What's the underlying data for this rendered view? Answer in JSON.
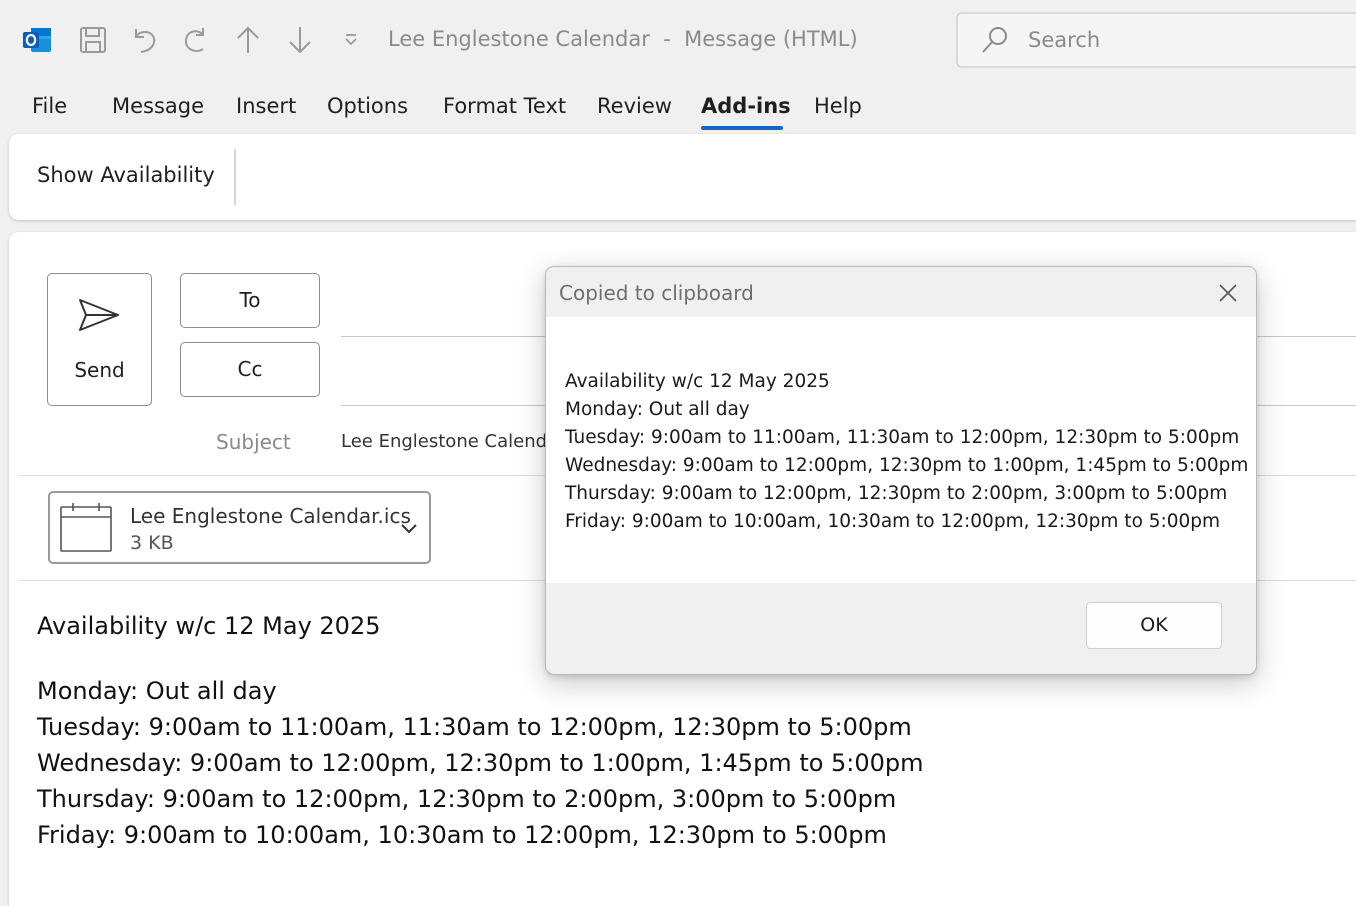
{
  "titlebar": {
    "title": "Lee Englestone Calendar  -  Message (HTML)",
    "search_placeholder": "Search",
    "icons": [
      "outlook-app-icon",
      "save-icon",
      "undo-icon",
      "redo-icon",
      "up-arrow-icon",
      "down-arrow-icon",
      "customize-dropdown-icon"
    ]
  },
  "menu": {
    "items": [
      "File",
      "Message",
      "Insert",
      "Options",
      "Format Text",
      "Review",
      "Add-ins",
      "Help"
    ],
    "active": "Add-ins"
  },
  "ribbon": {
    "show_availability": "Show Availability"
  },
  "compose": {
    "send_label": "Send",
    "to_label": "To",
    "cc_label": "Cc",
    "subject_label": "Subject",
    "subject_value": "Lee Englestone Calenda",
    "attachment": {
      "name": "Lee Englestone Calendar.ics",
      "size": "3 KB"
    },
    "body": {
      "title": "Availability w/c 12 May 2025",
      "lines": [
        "Monday: Out all day",
        "Tuesday: 9:00am to 11:00am, 11:30am to 12:00pm, 12:30pm to 5:00pm",
        "Wednesday: 9:00am to 12:00pm, 12:30pm to 1:00pm, 1:45pm to 5:00pm",
        "Thursday: 9:00am to 12:00pm, 12:30pm to 2:00pm, 3:00pm to 5:00pm",
        "Friday: 9:00am to 10:00am, 10:30am to 12:00pm, 12:30pm to 5:00pm"
      ]
    }
  },
  "dialog": {
    "title": "Copied to clipboard",
    "lines": [
      "Availability w/c 12 May 2025",
      "Monday: Out all day",
      "Tuesday: 9:00am to 11:00am, 11:30am to 12:00pm, 12:30pm to 5:00pm",
      "Wednesday: 9:00am to 12:00pm, 12:30pm to 1:00pm, 1:45pm to 5:00pm",
      "Thursday: 9:00am to 12:00pm, 12:30pm to 2:00pm, 3:00pm to 5:00pm",
      "Friday: 9:00am to 10:00am, 10:30am to 12:00pm, 12:30pm to 5:00pm"
    ],
    "ok_label": "OK"
  },
  "colors": {
    "accent": "#1568c2",
    "outlook_blue": "#0f6cbd",
    "window_bg": "#f0f0f0"
  }
}
